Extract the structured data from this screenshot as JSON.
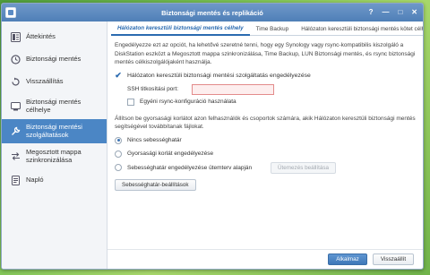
{
  "window": {
    "title": "Biztonsági mentés és replikáció"
  },
  "window_controls": [
    "?",
    "—",
    "□",
    "✕"
  ],
  "sidebar": {
    "items": [
      {
        "label": "Áttekintés",
        "icon": "overview-icon",
        "active": false
      },
      {
        "label": "Biztonsági mentés",
        "icon": "backup-icon",
        "active": false
      },
      {
        "label": "Visszaállítás",
        "icon": "restore-icon",
        "active": false
      },
      {
        "label": "Biztonsági mentés célhelye",
        "icon": "destination-icon",
        "active": false
      },
      {
        "label": "Biztonsági mentési szolgáltatások",
        "icon": "wrench-icon",
        "active": true
      },
      {
        "label": "Megosztott mappa szinkronizálása",
        "icon": "sync-icon",
        "active": false
      },
      {
        "label": "Napló",
        "icon": "log-icon",
        "active": false
      }
    ]
  },
  "tabs": [
    {
      "label": "Hálózaton keresztüli biztonsági mentés célhely",
      "active": true
    },
    {
      "label": "Time Backup",
      "active": false
    },
    {
      "label": "Hálózaton keresztüli biztonsági mentés kötet célhely",
      "active": false
    }
  ],
  "main": {
    "intro": "Engedélyezze ezt az opciót, ha lehetővé szeretné tenni, hogy egy Synology vagy rsync-kompatibilis kiszolgáló a DiskStation eszközt a Megosztott mappa szinkronizálása, Time Backup, LUN Biztonsági mentés, és rsync biztonsági mentés célkiszolgálójaként használja.",
    "enable_service_label": "Hálózaton keresztüli biztonsági mentési szolgáltatás engedélyezése",
    "enable_service_checked": true,
    "ssh_port_label": "SSH titkosítási port:",
    "ssh_port_value": "",
    "custom_rsync_label": "Egyéni rsync-konfiguráció használata",
    "custom_rsync_checked": false,
    "speed_intro": "Állítson be gyorsasági korlátot azon felhasználók és csoportok számára, akik Hálózaton keresztüli biztonsági mentés segítségével továbbítanak fájlokat.",
    "radio_options": [
      {
        "label": "Nincs sebességhatár",
        "checked": true
      },
      {
        "label": "Gyorsasági korlát engedélyezése",
        "checked": false
      },
      {
        "label": "Sebességhatár engedélyezése ütemterv alapján",
        "checked": false
      }
    ],
    "schedule_button": "Ütemezés beállítása",
    "speed_settings_button": "Sebességhatár-beállítások"
  },
  "footer": {
    "apply_button": "Alkalmaz",
    "reset_button": "Visszaállít"
  },
  "colors": {
    "titlebar": "#5b8bc4",
    "accent": "#2b6bb0",
    "sidebar_active": "#4b86c5",
    "error_field": "#fdeeee"
  }
}
